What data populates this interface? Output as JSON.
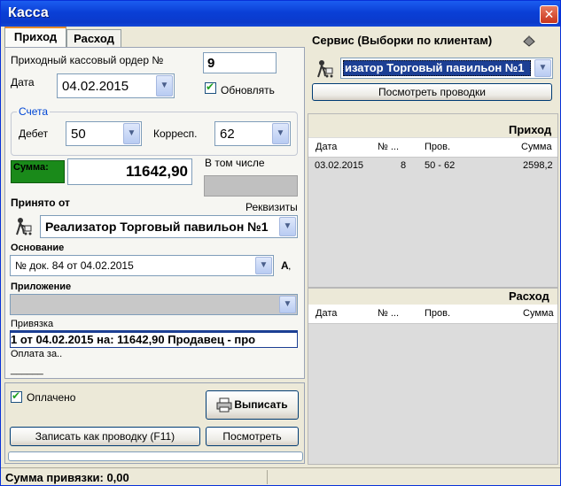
{
  "window": {
    "title": "Касса",
    "close_symbol": "✕"
  },
  "tabs": [
    {
      "label": "Приход"
    },
    {
      "label": "Расход"
    }
  ],
  "form": {
    "order_label": "Приходный кассовый ордер №",
    "order_number": "9",
    "date_label": "Дата",
    "date_value": "04.02.2015",
    "update_label": "Обновлять",
    "accounts_legend": "Счета",
    "debit_label": "Дебет",
    "debit_value": "50",
    "corr_label": "Корресп.",
    "corr_value": "62",
    "sum_label": "Сумма:",
    "sum_value": "11642,90",
    "including_label": "В том числе",
    "received_from_label": "Принято от",
    "details_label": "Реквизиты",
    "received_from_value": "Реализатор Торговый павильон №1",
    "basis_label": "Основание",
    "basis_value": "№ док. 84 от 04.02.2015",
    "attachment_label": "Приложение",
    "binding_label": "Привязка",
    "binding_value": "1  от  04.02.2015   на: 11642,90 Продавец - про",
    "payment_for_label": "Оплата за..",
    "underline_text": "______"
  },
  "bottom": {
    "paid_label": "Оплачено",
    "issue_button": "Выписать",
    "post_button": "Записать как проводку (F11)",
    "view_button": "Посмотреть"
  },
  "service": {
    "title": "Сервис (Выборки по клиентам)",
    "client_value": "изатор Торговый павильон №1",
    "view_postings_button": "Посмотреть проводки"
  },
  "income_grid": {
    "title": "Приход",
    "columns": [
      "Дата",
      "№ ...",
      "Пров.",
      "Сумма"
    ],
    "rows": [
      {
        "date": "03.02.2015",
        "num": "8",
        "prov": "50 - 62",
        "sum": "2598,2"
      }
    ]
  },
  "expense_grid": {
    "title": "Расход",
    "columns": [
      "Дата",
      "№ ...",
      "Пров.",
      "Сумма"
    ]
  },
  "status": {
    "binding_sum": "Сумма привязки: 0,00"
  },
  "colors": {
    "title_bar": "#0a3fd6",
    "sum_label_bg": "#1a8a1a",
    "grid_bg": "#dcdcdc",
    "selected_bg": "#1c3f94"
  },
  "icons": [
    "close-icon",
    "dropdown-arrow-icon",
    "checkbox-icon",
    "person-cart-icon",
    "stamp-icon",
    "printer-icon",
    "font-a-icon"
  ]
}
